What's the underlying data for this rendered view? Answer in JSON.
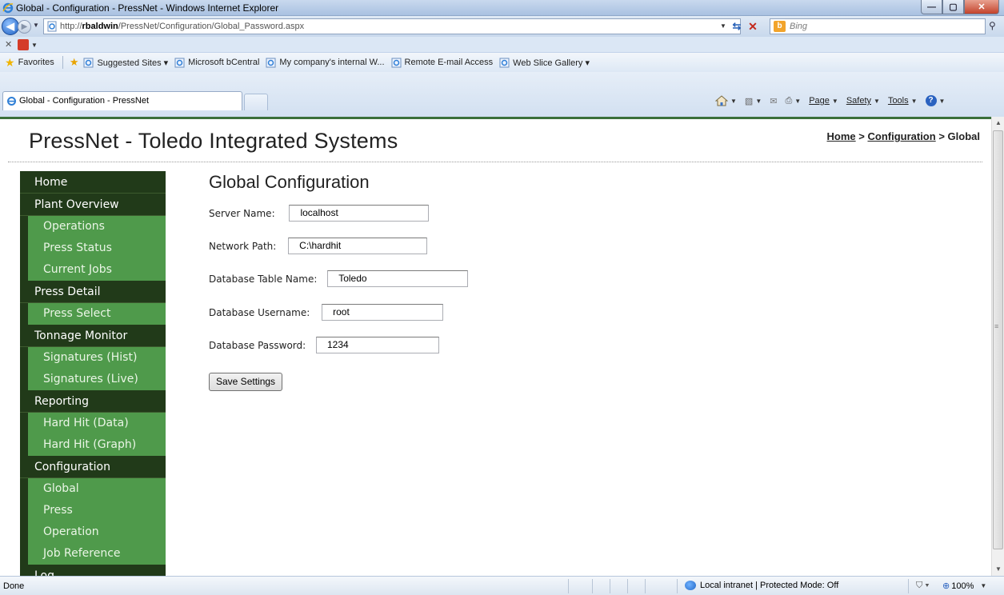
{
  "browser": {
    "window_title": "Global - Configuration - PressNet - Windows Internet Explorer",
    "url_prefix": "http://",
    "url_host": "rbaldwin",
    "url_path": "/PressNet/Configuration/Global_Password.aspx",
    "search_placeholder": "Bing",
    "favorites": {
      "label": "Favorites",
      "items": [
        "Suggested Sites ▾",
        "Microsoft bCentral",
        "My company's internal W...",
        "Remote E-mail Access",
        "Web Slice Gallery ▾"
      ]
    },
    "tab_title": "Global - Configuration - PressNet",
    "command_bar": {
      "page": "Page",
      "safety": "Safety",
      "tools": "Tools"
    },
    "status": {
      "text": "Done",
      "zone": "Local intranet | Protected Mode: Off",
      "zoom": "100%"
    }
  },
  "site": {
    "title": "PressNet - Toledo Integrated Systems",
    "breadcrumb": {
      "home": "Home",
      "sep1": ">",
      "configuration": "Configuration",
      "sep2": ">",
      "current": "Global"
    }
  },
  "sidebar": {
    "sections": [
      {
        "label": "Home",
        "items": []
      },
      {
        "label": "Plant Overview",
        "items": [
          "Operations",
          "Press Status",
          "Current Jobs"
        ]
      },
      {
        "label": "Press Detail",
        "items": [
          "Press Select"
        ]
      },
      {
        "label": "Tonnage Monitor",
        "items": [
          "Signatures (Hist)",
          "Signatures (Live)"
        ]
      },
      {
        "label": "Reporting",
        "items": [
          "Hard Hit (Data)",
          "Hard Hit (Graph)"
        ]
      },
      {
        "label": "Configuration",
        "items": [
          "Global",
          "Press",
          "Operation",
          "Job Reference"
        ]
      },
      {
        "label": "Log",
        "items": []
      }
    ]
  },
  "form": {
    "heading": "Global Configuration",
    "server_name": {
      "label": "Server Name:",
      "value": "localhost"
    },
    "network_path": {
      "label": "Network Path:",
      "value": "C:\\hardhit"
    },
    "db_table": {
      "label": "Database Table Name:",
      "value": "Toledo"
    },
    "db_username": {
      "label": "Database Username:",
      "value": "root"
    },
    "db_password": {
      "label": "Database Password:",
      "value": "1234"
    },
    "save_label": "Save Settings"
  },
  "colors": {
    "nav_header": "#213a19",
    "nav_item": "#4f9a4b",
    "accent_rule": "#3a6f3a"
  }
}
